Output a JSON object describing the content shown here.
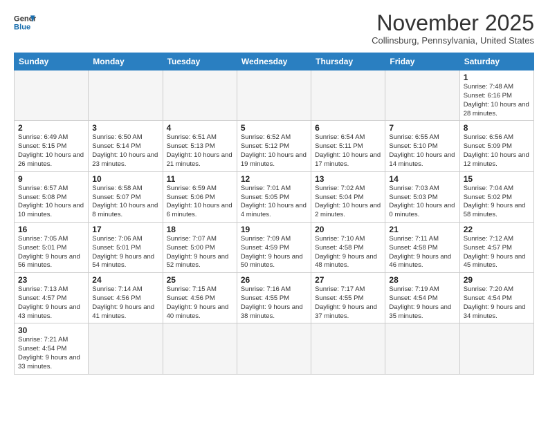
{
  "logo": {
    "line1": "General",
    "line2": "Blue"
  },
  "title": "November 2025",
  "subtitle": "Collinsburg, Pennsylvania, United States",
  "days_of_week": [
    "Sunday",
    "Monday",
    "Tuesday",
    "Wednesday",
    "Thursday",
    "Friday",
    "Saturday"
  ],
  "weeks": [
    [
      {
        "day": "",
        "info": ""
      },
      {
        "day": "",
        "info": ""
      },
      {
        "day": "",
        "info": ""
      },
      {
        "day": "",
        "info": ""
      },
      {
        "day": "",
        "info": ""
      },
      {
        "day": "",
        "info": ""
      },
      {
        "day": "1",
        "info": "Sunrise: 7:48 AM\nSunset: 6:16 PM\nDaylight: 10 hours\nand 28 minutes."
      }
    ],
    [
      {
        "day": "2",
        "info": "Sunrise: 6:49 AM\nSunset: 5:15 PM\nDaylight: 10 hours\nand 26 minutes."
      },
      {
        "day": "3",
        "info": "Sunrise: 6:50 AM\nSunset: 5:14 PM\nDaylight: 10 hours\nand 23 minutes."
      },
      {
        "day": "4",
        "info": "Sunrise: 6:51 AM\nSunset: 5:13 PM\nDaylight: 10 hours\nand 21 minutes."
      },
      {
        "day": "5",
        "info": "Sunrise: 6:52 AM\nSunset: 5:12 PM\nDaylight: 10 hours\nand 19 minutes."
      },
      {
        "day": "6",
        "info": "Sunrise: 6:54 AM\nSunset: 5:11 PM\nDaylight: 10 hours\nand 17 minutes."
      },
      {
        "day": "7",
        "info": "Sunrise: 6:55 AM\nSunset: 5:10 PM\nDaylight: 10 hours\nand 14 minutes."
      },
      {
        "day": "8",
        "info": "Sunrise: 6:56 AM\nSunset: 5:09 PM\nDaylight: 10 hours\nand 12 minutes."
      }
    ],
    [
      {
        "day": "9",
        "info": "Sunrise: 6:57 AM\nSunset: 5:08 PM\nDaylight: 10 hours\nand 10 minutes."
      },
      {
        "day": "10",
        "info": "Sunrise: 6:58 AM\nSunset: 5:07 PM\nDaylight: 10 hours\nand 8 minutes."
      },
      {
        "day": "11",
        "info": "Sunrise: 6:59 AM\nSunset: 5:06 PM\nDaylight: 10 hours\nand 6 minutes."
      },
      {
        "day": "12",
        "info": "Sunrise: 7:01 AM\nSunset: 5:05 PM\nDaylight: 10 hours\nand 4 minutes."
      },
      {
        "day": "13",
        "info": "Sunrise: 7:02 AM\nSunset: 5:04 PM\nDaylight: 10 hours\nand 2 minutes."
      },
      {
        "day": "14",
        "info": "Sunrise: 7:03 AM\nSunset: 5:03 PM\nDaylight: 10 hours\nand 0 minutes."
      },
      {
        "day": "15",
        "info": "Sunrise: 7:04 AM\nSunset: 5:02 PM\nDaylight: 9 hours\nand 58 minutes."
      }
    ],
    [
      {
        "day": "16",
        "info": "Sunrise: 7:05 AM\nSunset: 5:01 PM\nDaylight: 9 hours\nand 56 minutes."
      },
      {
        "day": "17",
        "info": "Sunrise: 7:06 AM\nSunset: 5:01 PM\nDaylight: 9 hours\nand 54 minutes."
      },
      {
        "day": "18",
        "info": "Sunrise: 7:07 AM\nSunset: 5:00 PM\nDaylight: 9 hours\nand 52 minutes."
      },
      {
        "day": "19",
        "info": "Sunrise: 7:09 AM\nSunset: 4:59 PM\nDaylight: 9 hours\nand 50 minutes."
      },
      {
        "day": "20",
        "info": "Sunrise: 7:10 AM\nSunset: 4:58 PM\nDaylight: 9 hours\nand 48 minutes."
      },
      {
        "day": "21",
        "info": "Sunrise: 7:11 AM\nSunset: 4:58 PM\nDaylight: 9 hours\nand 46 minutes."
      },
      {
        "day": "22",
        "info": "Sunrise: 7:12 AM\nSunset: 4:57 PM\nDaylight: 9 hours\nand 45 minutes."
      }
    ],
    [
      {
        "day": "23",
        "info": "Sunrise: 7:13 AM\nSunset: 4:57 PM\nDaylight: 9 hours\nand 43 minutes."
      },
      {
        "day": "24",
        "info": "Sunrise: 7:14 AM\nSunset: 4:56 PM\nDaylight: 9 hours\nand 41 minutes."
      },
      {
        "day": "25",
        "info": "Sunrise: 7:15 AM\nSunset: 4:56 PM\nDaylight: 9 hours\nand 40 minutes."
      },
      {
        "day": "26",
        "info": "Sunrise: 7:16 AM\nSunset: 4:55 PM\nDaylight: 9 hours\nand 38 minutes."
      },
      {
        "day": "27",
        "info": "Sunrise: 7:17 AM\nSunset: 4:55 PM\nDaylight: 9 hours\nand 37 minutes."
      },
      {
        "day": "28",
        "info": "Sunrise: 7:19 AM\nSunset: 4:54 PM\nDaylight: 9 hours\nand 35 minutes."
      },
      {
        "day": "29",
        "info": "Sunrise: 7:20 AM\nSunset: 4:54 PM\nDaylight: 9 hours\nand 34 minutes."
      }
    ],
    [
      {
        "day": "30",
        "info": "Sunrise: 7:21 AM\nSunset: 4:54 PM\nDaylight: 9 hours\nand 33 minutes."
      },
      {
        "day": "",
        "info": ""
      },
      {
        "day": "",
        "info": ""
      },
      {
        "day": "",
        "info": ""
      },
      {
        "day": "",
        "info": ""
      },
      {
        "day": "",
        "info": ""
      },
      {
        "day": "",
        "info": ""
      }
    ]
  ]
}
